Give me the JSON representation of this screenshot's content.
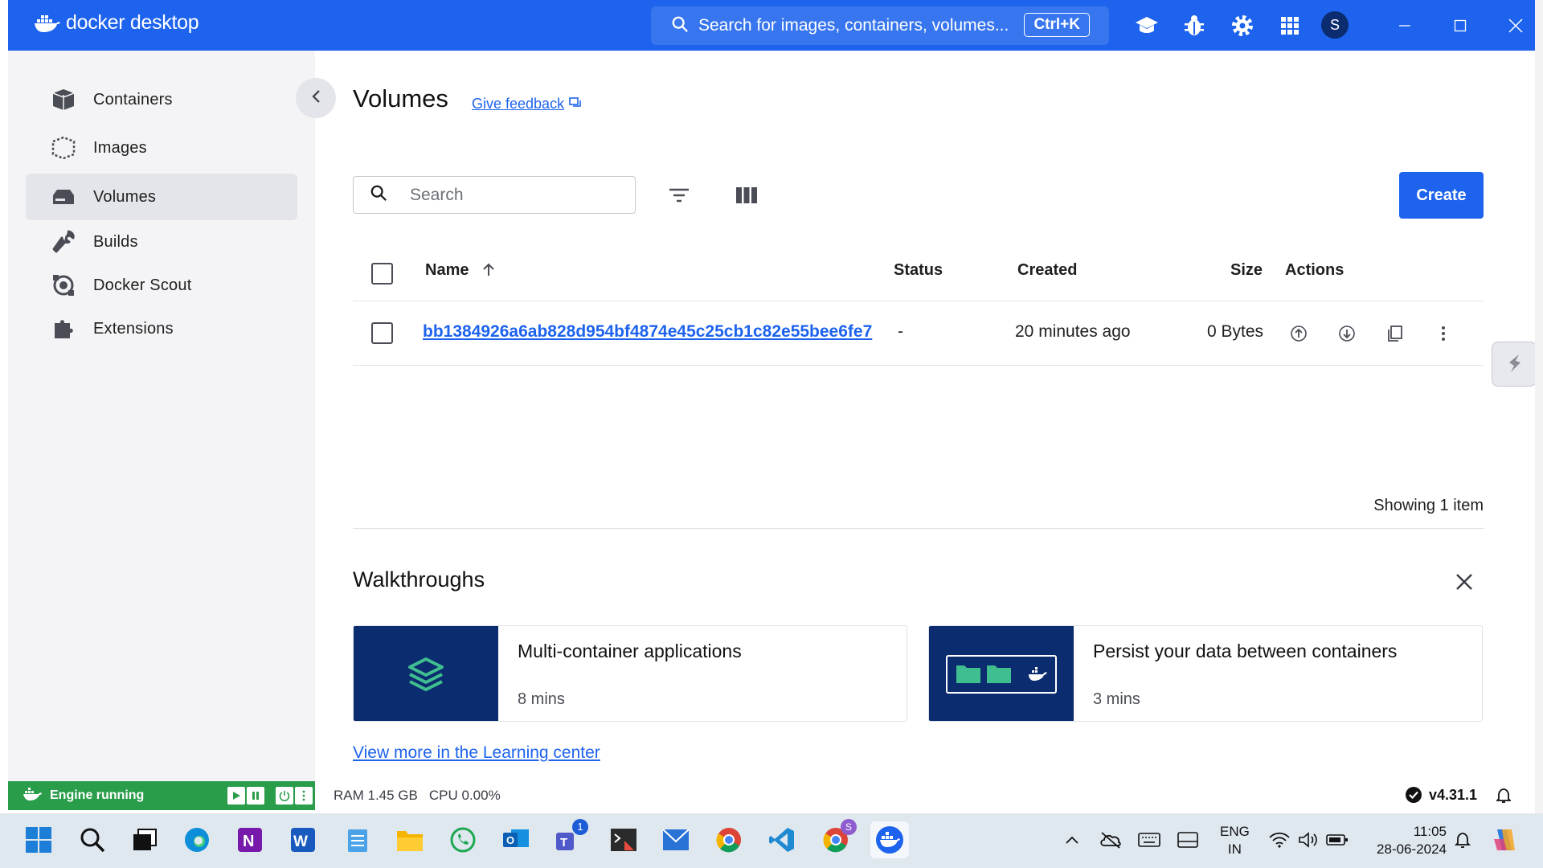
{
  "app": {
    "brand": "docker desktop"
  },
  "titlebar": {
    "search_text": "Search for images, containers, volumes...",
    "shortcut": "Ctrl+K",
    "avatar_initial": "S"
  },
  "sidebar": {
    "items": [
      {
        "label": "Containers",
        "icon": "containers-icon"
      },
      {
        "label": "Images",
        "icon": "images-icon"
      },
      {
        "label": "Volumes",
        "icon": "volumes-icon",
        "active": true
      },
      {
        "label": "Builds",
        "icon": "builds-icon"
      },
      {
        "label": "Docker Scout",
        "icon": "docker-scout-icon"
      },
      {
        "label": "Extensions",
        "icon": "extensions-icon"
      }
    ]
  },
  "main": {
    "title": "Volumes",
    "feedback_label": "Give feedback",
    "search_placeholder": "Search",
    "create_label": "Create",
    "table": {
      "headers": {
        "name": "Name",
        "status": "Status",
        "created": "Created",
        "size": "Size",
        "actions": "Actions"
      },
      "rows": [
        {
          "name": "bb1384926a6ab828d954bf4874e45c25cb1c82e55bee6fe7",
          "status": "-",
          "created": "20 minutes ago",
          "size": "0 Bytes"
        }
      ]
    },
    "showing": "Showing 1 item",
    "walkthroughs": {
      "title": "Walkthroughs",
      "cards": [
        {
          "title": "Multi-container applications",
          "duration": "8 mins"
        },
        {
          "title": "Persist your data between containers",
          "duration": "3 mins"
        }
      ],
      "learn_link": "View more in the Learning center"
    }
  },
  "footer": {
    "engine_status": "Engine running",
    "ram": "RAM 1.45 GB",
    "cpu": "CPU 0.00%",
    "version": "v4.31.1"
  },
  "taskbar": {
    "lang_top": "ENG",
    "lang_bottom": "IN",
    "time": "11:05",
    "date": "28-06-2024",
    "teams_badge": "1",
    "chrome_profile_badge": "S"
  },
  "colors": {
    "accent": "#1d63ed",
    "sidebar_bg": "#f4f4f6",
    "engine_green": "#2a9d4a",
    "card_thumb": "#0b2c6e"
  }
}
